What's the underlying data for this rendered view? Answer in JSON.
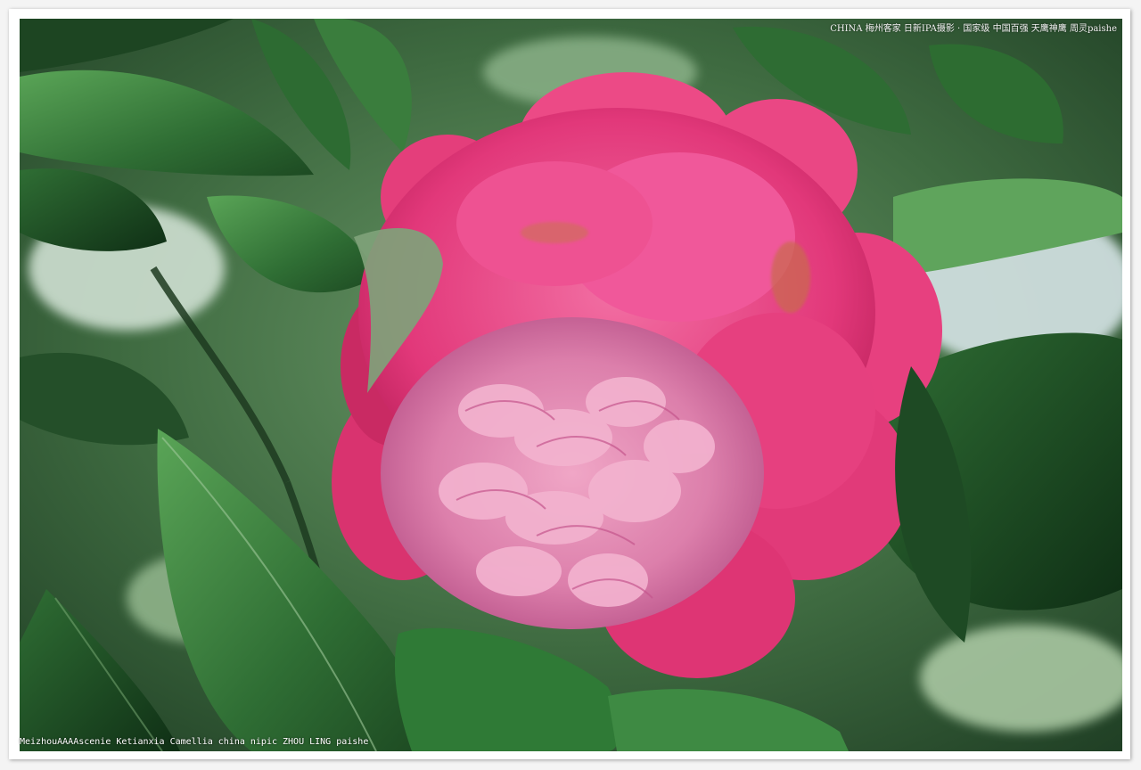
{
  "photo": {
    "subject": "camellia",
    "colors": {
      "petal": "#e8357a",
      "petal_light": "#f27aa8",
      "center": "#e68bb3",
      "leaf": "#2f6e34",
      "leaf_light": "#4f9a4e",
      "background": "#3e6a40"
    }
  },
  "watermark": {
    "top": "CHINA 梅州客家 日新IPA摄影 · 国家级 中国百强 天鹰神鹰 周灵paishe",
    "bottom": "MeizhouAAAAscenie Ketianxia Camellia china nipic ZHOU LING paishe"
  }
}
